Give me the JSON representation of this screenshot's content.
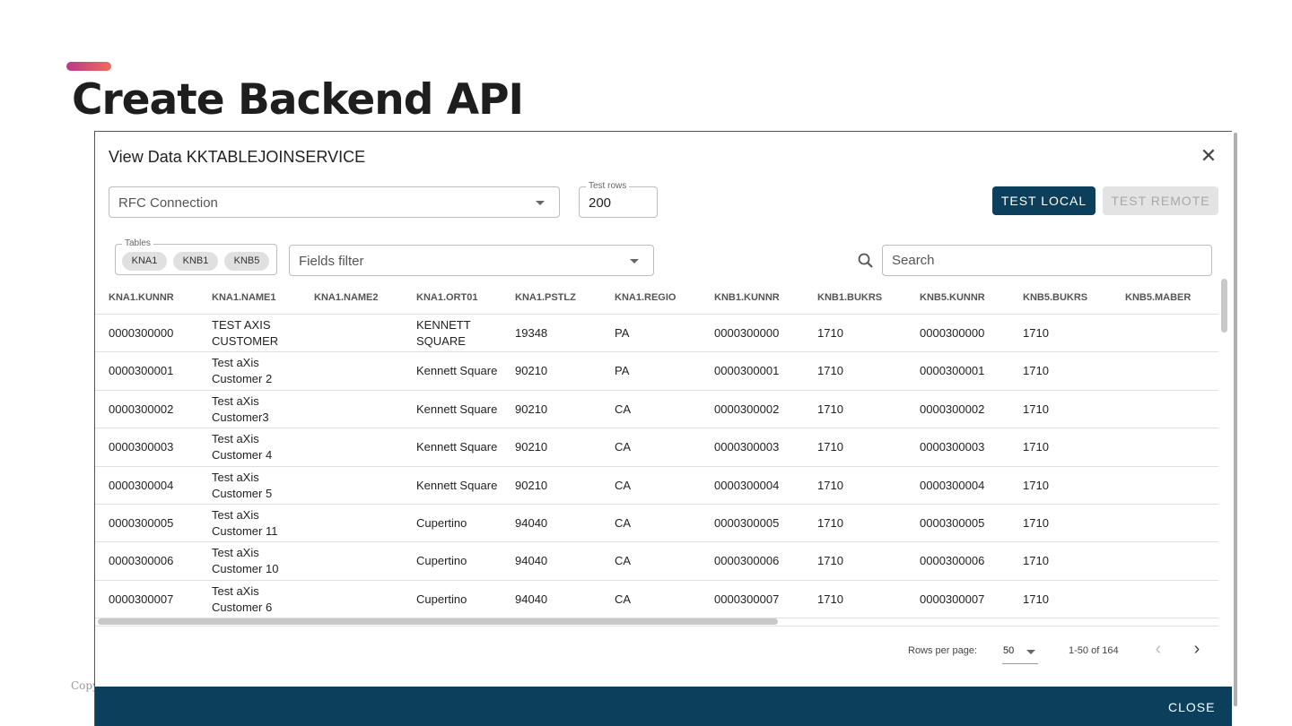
{
  "slide": {
    "title": "Create Backend API",
    "copyright": "Copyright",
    "accent_colors": [
      "#b83a8a",
      "#f06a5a"
    ]
  },
  "dialog": {
    "title": "View Data KKTABLEJOINSERVICE",
    "close_icon": "close-icon",
    "rfc_select_label": "RFC Connection",
    "test_rows_legend": "Test rows",
    "test_rows_value": "200",
    "test_local_label": "TEST LOCAL",
    "test_remote_label": "TEST REMOTE",
    "tables_legend": "Tables",
    "tables": [
      "KNA1",
      "KNB1",
      "KNB5"
    ],
    "fields_filter_label": "Fields filter",
    "search_placeholder": "Search",
    "primary_color": "#0b3f5c"
  },
  "table": {
    "columns": [
      "KNA1.KUNNR",
      "KNA1.NAME1",
      "KNA1.NAME2",
      "KNA1.ORT01",
      "KNA1.PSTLZ",
      "KNA1.REGIO",
      "KNB1.KUNNR",
      "KNB1.BUKRS",
      "KNB5.KUNNR",
      "KNB5.BUKRS",
      "KNB5.MABER"
    ],
    "rows": [
      [
        "0000300000",
        "TEST AXIS CUSTOMER",
        "",
        "KENNETT SQUARE",
        "19348",
        "PA",
        "0000300000",
        "1710",
        "0000300000",
        "1710",
        ""
      ],
      [
        "0000300001",
        "Test aXis Customer 2",
        "",
        "Kennett Square",
        "90210",
        "PA",
        "0000300001",
        "1710",
        "0000300001",
        "1710",
        ""
      ],
      [
        "0000300002",
        "Test aXis Customer3",
        "",
        "Kennett Square",
        "90210",
        "CA",
        "0000300002",
        "1710",
        "0000300002",
        "1710",
        ""
      ],
      [
        "0000300003",
        "Test aXis Customer 4",
        "",
        "Kennett Square",
        "90210",
        "CA",
        "0000300003",
        "1710",
        "0000300003",
        "1710",
        ""
      ],
      [
        "0000300004",
        "Test aXis Customer 5",
        "",
        "Kennett Square",
        "90210",
        "CA",
        "0000300004",
        "1710",
        "0000300004",
        "1710",
        ""
      ],
      [
        "0000300005",
        "Test aXis Customer 11",
        "",
        "Cupertino",
        "94040",
        "CA",
        "0000300005",
        "1710",
        "0000300005",
        "1710",
        ""
      ],
      [
        "0000300006",
        "Test aXis Customer 10",
        "",
        "Cupertino",
        "94040",
        "CA",
        "0000300006",
        "1710",
        "0000300006",
        "1710",
        ""
      ],
      [
        "0000300007",
        "Test aXis Customer 6",
        "",
        "Cupertino",
        "94040",
        "CA",
        "0000300007",
        "1710",
        "0000300007",
        "1710",
        ""
      ]
    ]
  },
  "pagination": {
    "rows_per_page_label": "Rows per page:",
    "rows_per_page_value": "50",
    "range_text": "1-50 of 164",
    "prev_icon": "chevron-left-icon",
    "next_icon": "chevron-right-icon"
  },
  "footer": {
    "close_label": "CLOSE"
  }
}
